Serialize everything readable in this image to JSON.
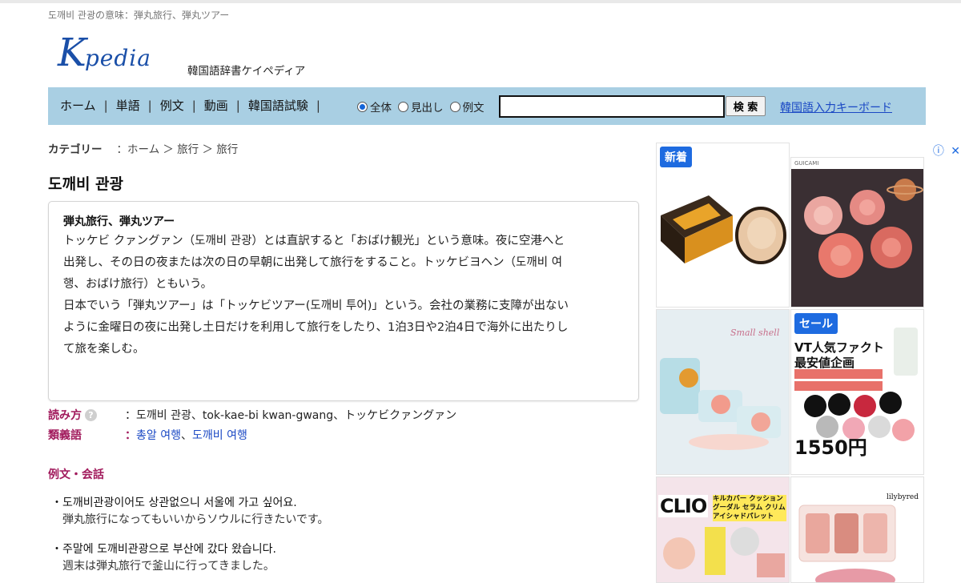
{
  "header": {
    "top_breadcrumb": "도깨비 관광の意味：弾丸旅行、弾丸ツアー",
    "logo_big": "K",
    "logo_rest": "pedia",
    "tagline": "韓国語辞書ケイペディア"
  },
  "nav": {
    "items": [
      "ホーム",
      "単語",
      "例文",
      "動画",
      "韓国語試験"
    ],
    "radios": [
      {
        "label": "全体",
        "checked": true
      },
      {
        "label": "見出し",
        "checked": false
      },
      {
        "label": "例文",
        "checked": false
      }
    ],
    "search_value": "",
    "search_button": "検 索",
    "keyboard_link": "韓国語入力キーボード"
  },
  "category": {
    "label": "カテゴリー",
    "path": "：ホーム ＞ 旅行 ＞ 旅行"
  },
  "entry": {
    "title": "도깨비 관광",
    "definition_head": "弾丸旅行、弾丸ツアー",
    "definition_lines": [
      "トッケビ クァングァン（도깨비 관광）とは直訳すると「おばけ観光」という意味。夜に空港へと",
      "出発し、その日の夜または次の日の早朝に出発して旅行をすること。トッケビヨヘン（도깨비 여",
      "행、おばけ旅行）ともいう。",
      "日本でいう「弾丸ツアー」は「トッケビツアー(도깨비 투어)」という。会社の業務に支障が出ない",
      "ように金曜日の夜に出発し土日だけを利用して旅行をしたり、1泊3日や2泊4日で海外に出たりし",
      "て旅を楽しむ。"
    ],
    "reading_label": "読み方",
    "reading_help": "?",
    "reading_value": "：도깨비 관광、tok-kae-bi kwan-gwang、トッケビクァングァン",
    "synonym_label": "類義語",
    "synonym_colon": "：",
    "synonyms": [
      "총알 여행",
      "도깨비 여행"
    ],
    "synonym_sep": "、"
  },
  "examples": {
    "heading": "例文・会話",
    "items": [
      {
        "kr": "・도깨비관광이어도 상관없으니 서울에 가고 싶어요.",
        "jp": "弾丸旅行になってもいいからソウルに行きたいです。"
      },
      {
        "kr": "・주말에 도깨비관광으로 부산에 갔다 왔습니다.",
        "jp": "週末は弾丸旅行で釜山に行ってきました。"
      }
    ]
  },
  "ads": {
    "badge_new": "新着",
    "badge_sale": "セール",
    "brand_guicami": "GUICAMI",
    "vt_line1": "VT人気ファクト",
    "vt_line2": "最安値企画",
    "vt_price": "1550円",
    "clio": "CLIO",
    "clio_copy": "キルカバー クッション グーダル セラム クリム アイシャドパレット",
    "lilybyred": "lilybyred",
    "small_shell": "Small shell",
    "info_icon": "ⓘ",
    "close_icon": "✕"
  }
}
